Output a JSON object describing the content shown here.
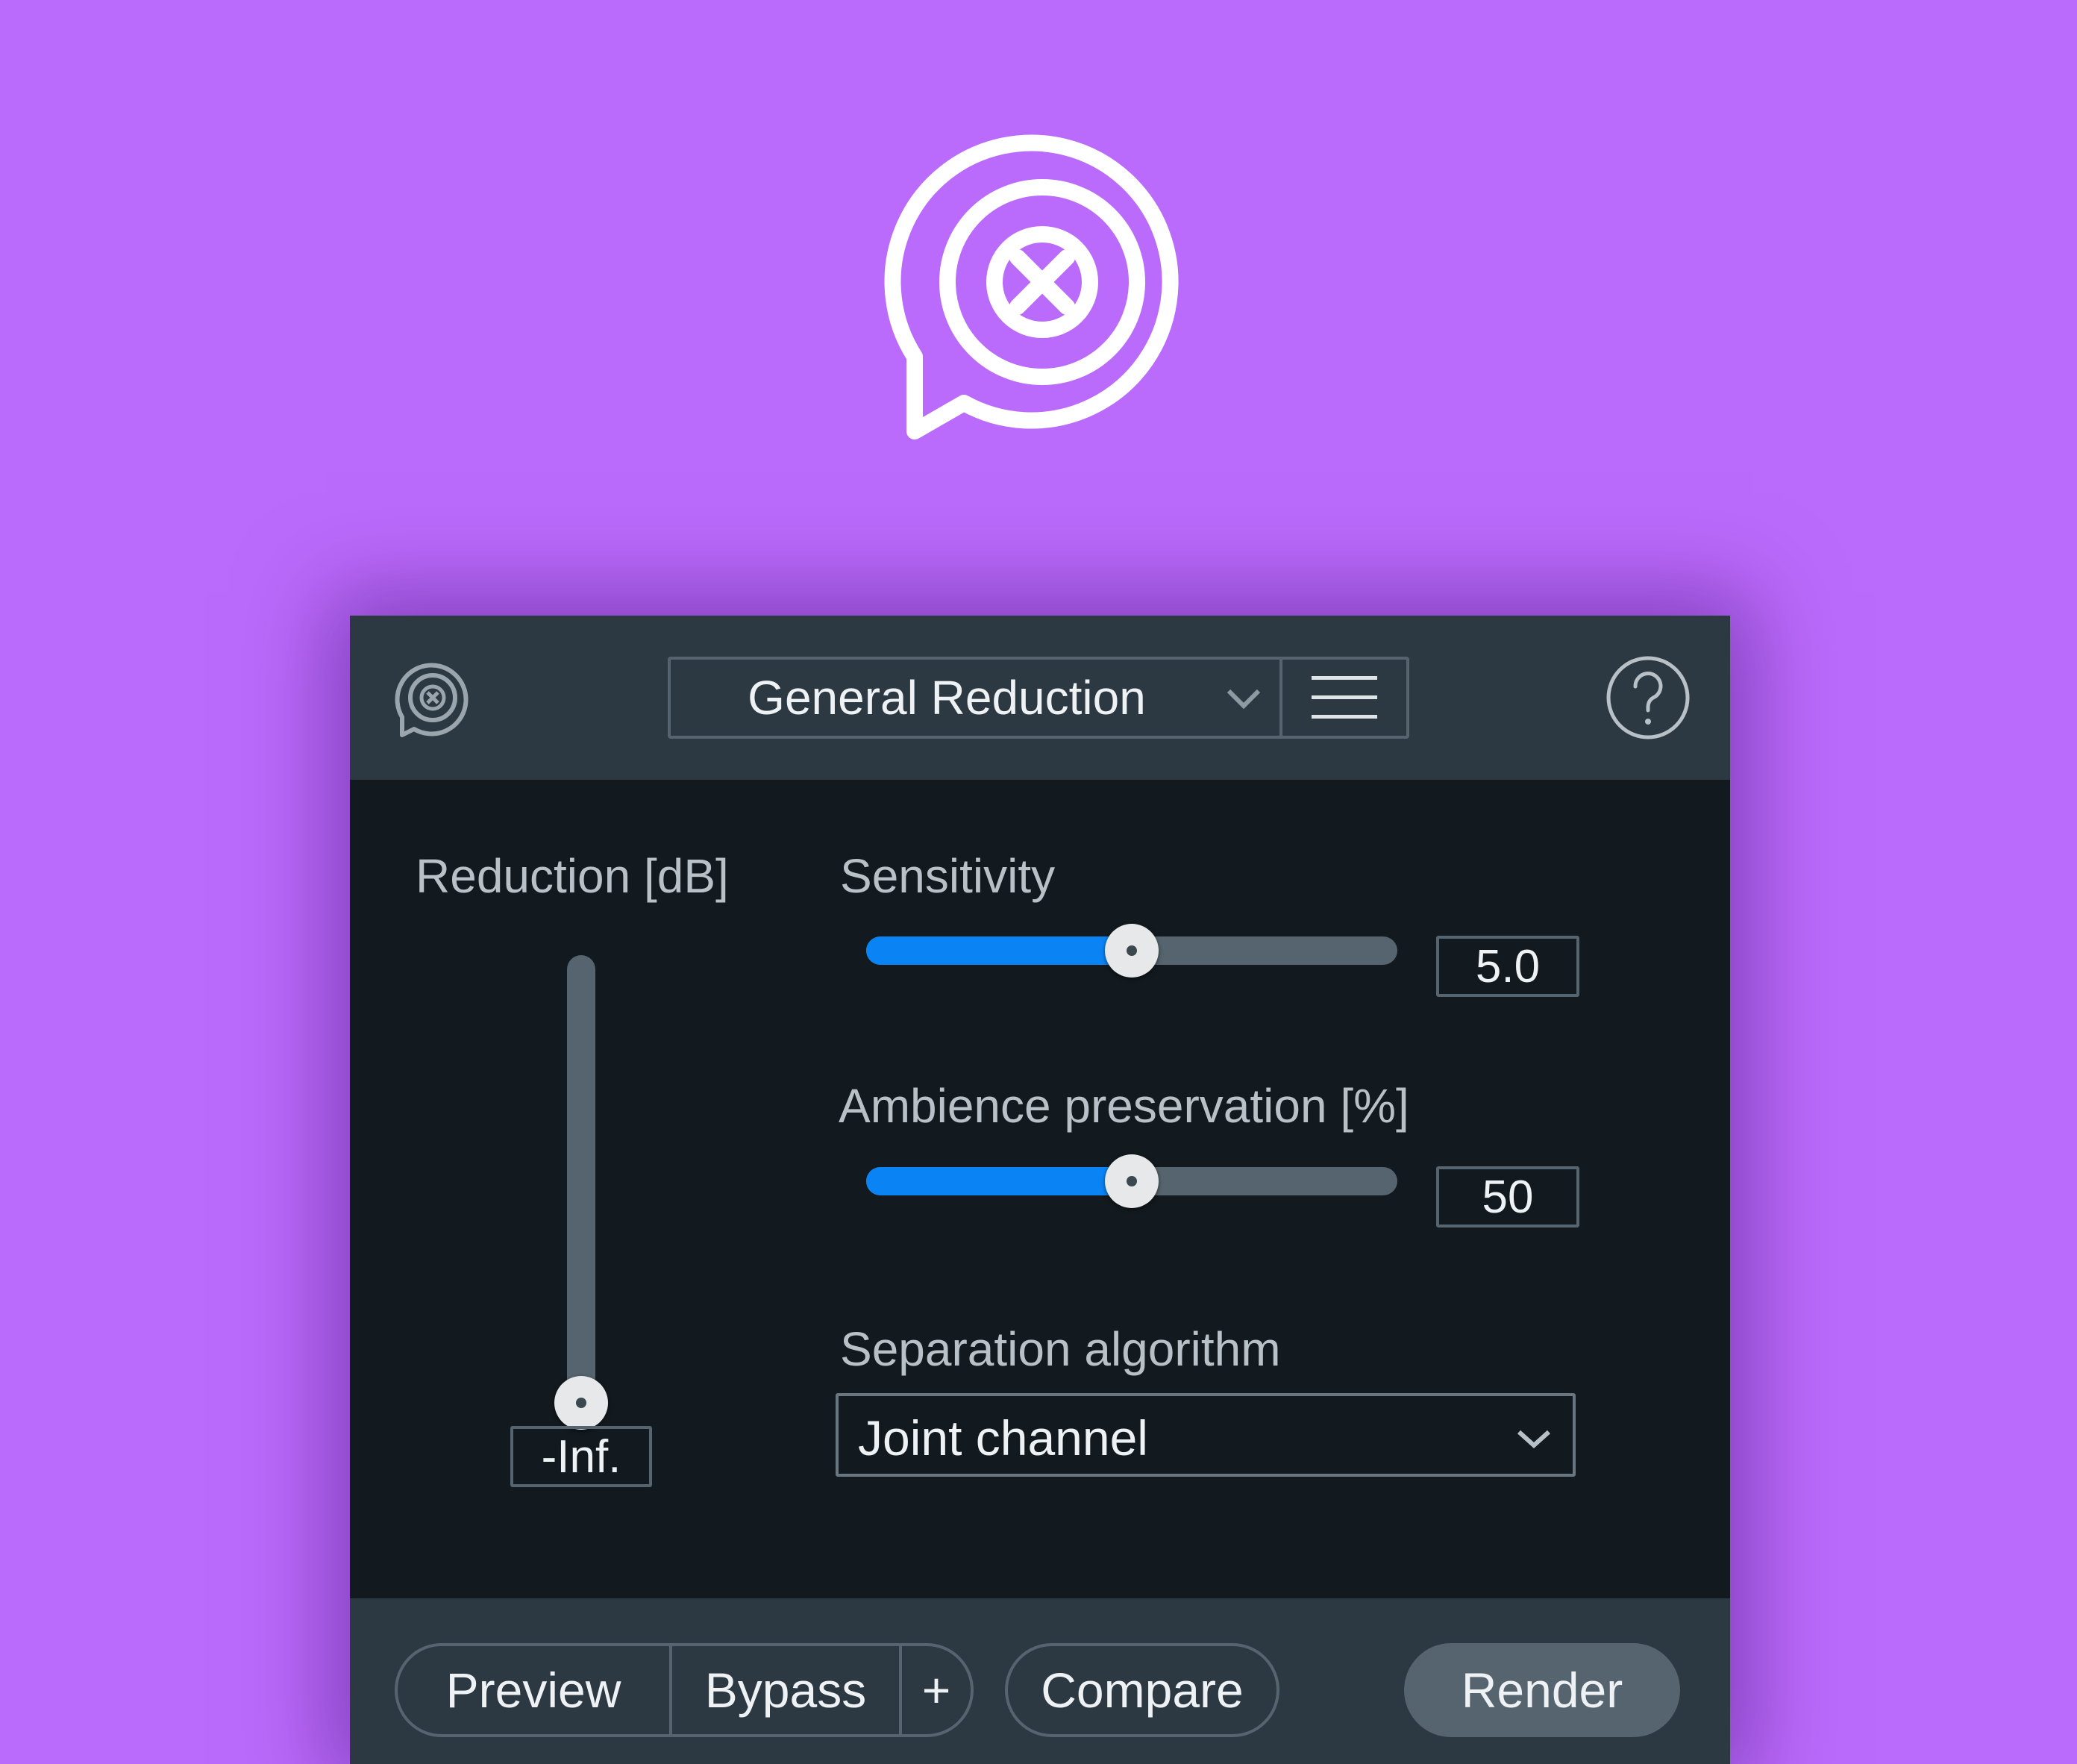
{
  "brand": {
    "logo_icon": "dialogue-isolate-icon",
    "background_color": "#bb6bfb"
  },
  "header": {
    "preset": "General Reduction",
    "preset_chevron_icon": "chevron-down-icon",
    "menu_icon": "hamburger-menu-icon",
    "help_icon": "help-icon"
  },
  "controls": {
    "reduction": {
      "label": "Reduction [dB]",
      "value": "-Inf.",
      "level": 0.0
    },
    "sensitivity": {
      "label": "Sensitivity",
      "value": "5.0",
      "level": 0.5
    },
    "ambience": {
      "label": "Ambience preservation [%]",
      "value": "50",
      "level": 0.5
    },
    "algorithm": {
      "label": "Separation algorithm",
      "value": "Joint channel"
    }
  },
  "footer": {
    "preview": "Preview",
    "bypass": "Bypass",
    "plus": "+",
    "compare": "Compare",
    "render": "Render"
  },
  "colors": {
    "accent": "#0a84f5",
    "panel": "#121a1f",
    "bar": "#2c3942"
  }
}
